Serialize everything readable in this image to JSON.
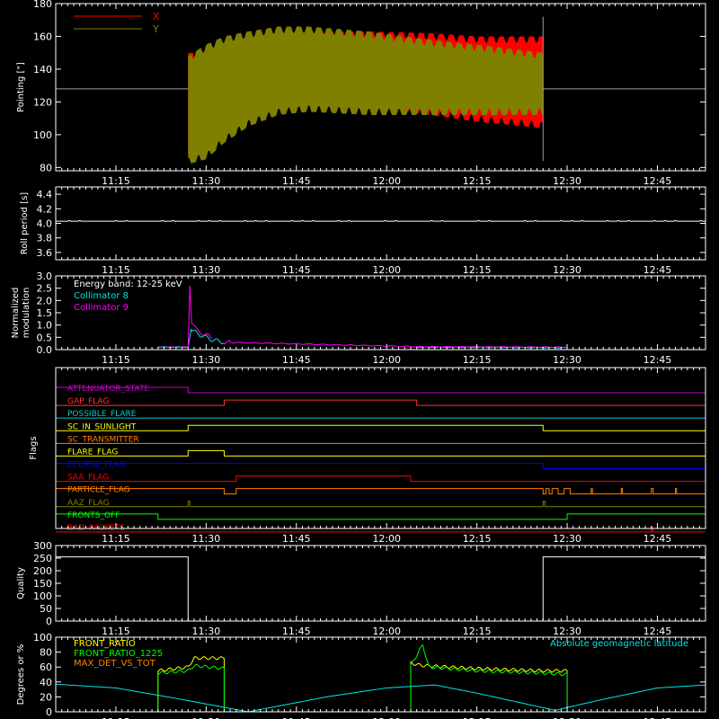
{
  "chart_data": [
    {
      "type": "line",
      "ylabel": "Pointing [\"]",
      "ylim": [
        78,
        180
      ],
      "xlim": [
        "11:05",
        "12:53"
      ],
      "x_ticks": [
        "11:15",
        "11:30",
        "11:45",
        "12:00",
        "12:15",
        "12:30",
        "12:45"
      ],
      "y_ticks": [
        80,
        100,
        120,
        140,
        160,
        180
      ],
      "legend_position": "top-left",
      "series": [
        {
          "name": "X",
          "color": "#ff0000",
          "data_start": "11:27",
          "data_end": "12:26",
          "upper": [
            [
              0,
              150
            ],
            [
              3,
              150
            ],
            [
              6,
              155
            ],
            [
              10,
              158
            ],
            [
              15,
              162
            ],
            [
              20,
              163
            ],
            [
              30,
              163
            ],
            [
              40,
              162
            ],
            [
              48,
              160
            ],
            [
              59,
              160
            ]
          ],
          "lower": [
            [
              0,
              88
            ],
            [
              3,
              90
            ],
            [
              6,
              100
            ],
            [
              10,
              110
            ],
            [
              15,
              117
            ],
            [
              20,
              120
            ],
            [
              30,
              118
            ],
            [
              40,
              112
            ],
            [
              48,
              108
            ],
            [
              59,
              104
            ]
          ]
        },
        {
          "name": "Y",
          "color": "#808000",
          "data_start": "11:27",
          "data_end": "12:26",
          "upper": [
            [
              0,
              148
            ],
            [
              3,
              155
            ],
            [
              6,
              160
            ],
            [
              10,
              163
            ],
            [
              15,
              166
            ],
            [
              20,
              166
            ],
            [
              30,
              163
            ],
            [
              40,
              158
            ],
            [
              48,
              155
            ],
            [
              59,
              150
            ]
          ],
          "lower": [
            [
              0,
              82
            ],
            [
              3,
              85
            ],
            [
              6,
              95
            ],
            [
              10,
              105
            ],
            [
              15,
              112
            ],
            [
              20,
              114
            ],
            [
              30,
              112
            ],
            [
              40,
              112
            ],
            [
              48,
              112
            ],
            [
              59,
              112
            ]
          ]
        }
      ],
      "reference_level": 128
    },
    {
      "type": "line",
      "ylabel": "Roll period [s]",
      "ylim": [
        3.5,
        4.5
      ],
      "x_ticks": [
        "11:15",
        "11:30",
        "11:45",
        "12:00",
        "12:15",
        "12:30",
        "12:45"
      ],
      "y_ticks": [
        3.6,
        3.8,
        4.0,
        4.2,
        4.4
      ],
      "series": [
        {
          "name": "",
          "color": "#ffffff",
          "value": 4.03
        }
      ]
    },
    {
      "type": "line",
      "ylabel": "Normalized\nmodulation",
      "ylim": [
        0,
        3.0
      ],
      "x_ticks": [
        "11:15",
        "11:30",
        "11:45",
        "12:00",
        "12:15",
        "12:30",
        "12:45"
      ],
      "y_ticks": [
        0.0,
        0.5,
        1.0,
        1.5,
        2.0,
        2.5,
        3.0
      ],
      "annotation": "Energy band: 12-25 keV",
      "series": [
        {
          "name": "Collimator 8",
          "color": "#00e5e5",
          "points": [
            [
              "11:22",
              0.1
            ],
            [
              "11:27",
              0.1
            ],
            [
              "11:27.5",
              0.8
            ],
            [
              "11:29",
              0.6
            ],
            [
              "11:31",
              0.4
            ],
            [
              "11:33",
              0.3
            ],
            [
              "12:05",
              0.1
            ],
            [
              "12:30",
              0.08
            ]
          ]
        },
        {
          "name": "Collimator 9",
          "color": "#ff00ff",
          "points": [
            [
              "11:22",
              0.1
            ],
            [
              "11:27",
              0.1
            ],
            [
              "11:27.3",
              2.6
            ],
            [
              "11:27.6",
              1.0
            ],
            [
              "11:29",
              0.7
            ],
            [
              "11:31",
              0.5
            ],
            [
              "11:33",
              0.3
            ],
            [
              "12:05",
              0.12
            ],
            [
              "12:30",
              0.1
            ]
          ]
        }
      ]
    },
    {
      "type": "line",
      "ylabel": "Flags",
      "x_ticks": [
        "11:15",
        "11:30",
        "11:45",
        "12:00",
        "12:15",
        "12:30",
        "12:45"
      ],
      "series": [
        {
          "name": "ATTENUATOR_STATE",
          "color": "#cc00cc",
          "high": [
            [
              "11:05",
              "11:27"
            ]
          ]
        },
        {
          "name": "GAP_FLAG",
          "color": "#ff3333",
          "high": [
            [
              "11:33",
              "12:05"
            ]
          ]
        },
        {
          "name": "POSSIBLE_FLARE",
          "color": "#00cccc",
          "high": []
        },
        {
          "name": "SC_IN_SUNLIGHT",
          "color": "#ffff00",
          "high": [
            [
              "11:27",
              "12:26"
            ]
          ]
        },
        {
          "name": "SC_TRANSMITTER",
          "color": "#ff8000",
          "high": []
        },
        {
          "name": "FLARE_FLAG",
          "color": "#ffff00",
          "high": [
            [
              "11:27",
              "11:33"
            ]
          ]
        },
        {
          "name": "ECLIPSE_FLAG",
          "color": "#0000ff",
          "high": [
            [
              "11:05",
              "12:26"
            ]
          ]
        },
        {
          "name": "SAA_FLAG",
          "color": "#ff0000",
          "high": [
            [
              "11:35",
              "12:04"
            ]
          ]
        },
        {
          "name": "PARTICLE_FLAG",
          "color": "#ff8000",
          "high": [
            [
              "11:05",
              "11:33"
            ],
            [
              "11:35",
              "12:26"
            ],
            [
              "12:26.5",
              "12:27"
            ],
            [
              "12:27.5",
              "12:28.5"
            ],
            [
              "12:29.5",
              "12:30.5"
            ],
            [
              "12:34",
              "12:34.2"
            ],
            [
              "12:39",
              "12:39.2"
            ],
            [
              "12:44",
              "12:44.3"
            ],
            [
              "12:48",
              "12:48.2"
            ]
          ]
        },
        {
          "name": "AAZ_FLAG",
          "color": "#808000",
          "high": [
            [
              "11:27",
              "11:27.3"
            ],
            [
              "12:26",
              "12:26.3"
            ]
          ]
        },
        {
          "name": "FRONTS_OFF",
          "color": "#00ff00",
          "high": [
            [
              "11:05",
              "11:22"
            ],
            [
              "12:30",
              "12:53"
            ]
          ]
        },
        {
          "name": "BAD_PACKETS",
          "color": "#ff0000",
          "high": [
            [
              "12:44",
              "12:44.2"
            ]
          ]
        }
      ]
    },
    {
      "type": "line",
      "ylabel": "Quality",
      "ylim": [
        0,
        300
      ],
      "x_ticks": [
        "11:15",
        "11:30",
        "11:45",
        "12:00",
        "12:15",
        "12:30",
        "12:45"
      ],
      "y_ticks": [
        0,
        50,
        100,
        150,
        200,
        250,
        300
      ],
      "series": [
        {
          "name": "",
          "color": "#ffffff",
          "points": [
            [
              "11:05",
              255
            ],
            [
              "11:27",
              255
            ],
            [
              "11:27",
              0
            ],
            [
              "12:26",
              0
            ],
            [
              "12:26",
              255
            ],
            [
              "12:53",
              255
            ]
          ]
        }
      ]
    },
    {
      "type": "line",
      "ylabel": "Degrees or %",
      "ylim": [
        0,
        100
      ],
      "x_ticks": [
        "11:15",
        "11:30",
        "11:45",
        "12:00",
        "12:15",
        "12:30",
        "12:45"
      ],
      "y_ticks": [
        0,
        20,
        40,
        60,
        80,
        100
      ],
      "annotation": "Absolute geomagnetic latitude",
      "series": [
        {
          "name": "FRONT_RATIO",
          "color": "#ffff00",
          "points": [
            [
              "11:22",
              0
            ],
            [
              "11:22",
              55
            ],
            [
              "11:27",
              60
            ],
            [
              "11:28",
              72
            ],
            [
              "11:33",
              72
            ],
            [
              "11:33",
              0
            ],
            [
              "12:04",
              0
            ],
            [
              "12:04",
              65
            ],
            [
              "12:06",
              62
            ],
            [
              "12:15",
              58
            ],
            [
              "12:26",
              55
            ],
            [
              "12:30",
              55
            ],
            [
              "12:30",
              0
            ]
          ]
        },
        {
          "name": "FRONT_RATIO_1225",
          "color": "#00ff00",
          "points": [
            [
              "11:22",
              0
            ],
            [
              "11:22",
              52
            ],
            [
              "11:27",
              55
            ],
            [
              "11:28",
              62
            ],
            [
              "11:33",
              58
            ],
            [
              "11:33",
              0
            ],
            [
              "12:04",
              0
            ],
            [
              "12:04",
              62
            ],
            [
              "12:06",
              90
            ],
            [
              "12:07",
              60
            ],
            [
              "12:15",
              55
            ],
            [
              "12:26",
              52
            ],
            [
              "12:30",
              50
            ],
            [
              "12:30",
              0
            ]
          ]
        },
        {
          "name": "MAX_DET_VS_TOT",
          "color": "#ff8000",
          "value": 0
        },
        {
          "name": "Absolute geomagnetic latitude",
          "color": "#00e5e5",
          "points": [
            [
              "11:05",
              37
            ],
            [
              "11:15",
              32
            ],
            [
              "11:25",
              18
            ],
            [
              "11:37",
              0
            ],
            [
              "11:50",
              20
            ],
            [
              "12:00",
              32
            ],
            [
              "12:08",
              36
            ],
            [
              "12:15",
              25
            ],
            [
              "12:28",
              2
            ],
            [
              "12:35",
              15
            ],
            [
              "12:45",
              32
            ],
            [
              "12:53",
              36
            ]
          ]
        }
      ]
    }
  ]
}
